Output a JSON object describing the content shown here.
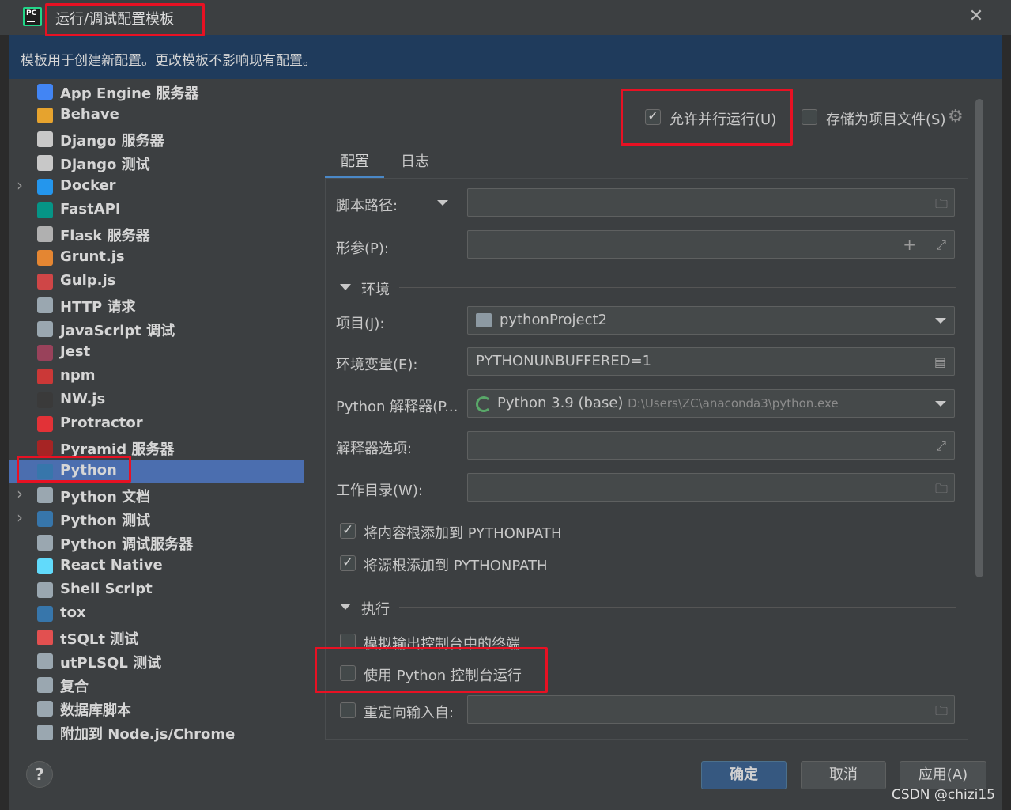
{
  "window": {
    "title": "运行/调试配置模板"
  },
  "banner": {
    "text": "模板用于创建新配置。更改模板不影响现有配置。"
  },
  "tree": {
    "items": [
      {
        "label": "App Engine 服务器",
        "icon": "app-engine-icon",
        "color": "#4285f4",
        "expandable": false
      },
      {
        "label": "Behave",
        "icon": "behave-icon",
        "color": "#e6a32e",
        "expandable": false
      },
      {
        "label": "Django 服务器",
        "icon": "django-icon",
        "color": "#c8c8c8",
        "expandable": false
      },
      {
        "label": "Django 测试",
        "icon": "django-test-icon",
        "color": "#c8c8c8",
        "expandable": false
      },
      {
        "label": "Docker",
        "icon": "docker-icon",
        "color": "#2496ed",
        "expandable": true
      },
      {
        "label": "FastAPI",
        "icon": "fastapi-icon",
        "color": "#059486",
        "expandable": false
      },
      {
        "label": "Flask 服务器",
        "icon": "flask-icon",
        "color": "#b0b0b0",
        "expandable": false
      },
      {
        "label": "Grunt.js",
        "icon": "grunt-icon",
        "color": "#e48632",
        "expandable": false
      },
      {
        "label": "Gulp.js",
        "icon": "gulp-icon",
        "color": "#cf4647",
        "expandable": false
      },
      {
        "label": "HTTP 请求",
        "icon": "http-api-icon",
        "color": "#9aa7b0",
        "expandable": false
      },
      {
        "label": "JavaScript 调试",
        "icon": "js-debug-icon",
        "color": "#9aa7b0",
        "expandable": false
      },
      {
        "label": "Jest",
        "icon": "jest-icon",
        "color": "#99425b",
        "expandable": false
      },
      {
        "label": "npm",
        "icon": "npm-icon",
        "color": "#cb3837",
        "expandable": false
      },
      {
        "label": "NW.js",
        "icon": "nwjs-icon",
        "color": "#3a3a3a",
        "expandable": false
      },
      {
        "label": "Protractor",
        "icon": "protractor-icon",
        "color": "#e23237",
        "expandable": false
      },
      {
        "label": "Pyramid 服务器",
        "icon": "pyramid-icon",
        "color": "#a62424",
        "expandable": false
      },
      {
        "label": "Python",
        "icon": "python-icon",
        "color": "#3776ab",
        "expandable": false,
        "selected": true
      },
      {
        "label": "Python 文档",
        "icon": "python-docs-icon",
        "color": "#9aa7b0",
        "expandable": true
      },
      {
        "label": "Python 测试",
        "icon": "python-test-icon",
        "color": "#3776ab",
        "expandable": true
      },
      {
        "label": "Python 调试服务器",
        "icon": "python-debug-server-icon",
        "color": "#9aa7b0",
        "expandable": false
      },
      {
        "label": "React Native",
        "icon": "react-icon",
        "color": "#61dafb",
        "expandable": false
      },
      {
        "label": "Shell Script",
        "icon": "shell-icon",
        "color": "#9aa7b0",
        "expandable": false
      },
      {
        "label": "tox",
        "icon": "tox-icon",
        "color": "#3776ab",
        "expandable": false
      },
      {
        "label": "tSQLt 测试",
        "icon": "tsqlt-icon",
        "color": "#e25050",
        "expandable": false
      },
      {
        "label": "utPLSQL 测试",
        "icon": "utplsql-icon",
        "color": "#9aa7b0",
        "expandable": false
      },
      {
        "label": "复合",
        "icon": "compound-icon",
        "color": "#9aa7b0",
        "expandable": false
      },
      {
        "label": "数据库脚本",
        "icon": "database-script-icon",
        "color": "#9aa7b0",
        "expandable": false
      },
      {
        "label": "附加到 Node.js/Chrome",
        "icon": "attach-node-icon",
        "color": "#9aa7b0",
        "expandable": false
      }
    ]
  },
  "top_options": {
    "allow_parallel": {
      "label": "允许并行运行(U)",
      "checked": true
    },
    "store_as_project_file": {
      "label": "存储为项目文件(S)",
      "checked": false
    }
  },
  "tabs": [
    {
      "label": "配置",
      "active": true
    },
    {
      "label": "日志",
      "active": false
    }
  ],
  "form": {
    "script_path": {
      "label": "脚本路径:",
      "value": ""
    },
    "parameters": {
      "label": "形参(P):",
      "value": ""
    },
    "environment_section": {
      "label": "环境"
    },
    "project": {
      "label": "项目(J):",
      "value": "pythonProject2"
    },
    "env_vars": {
      "label": "环境变量(E):",
      "value": "PYTHONUNBUFFERED=1"
    },
    "interpreter": {
      "label": "Python 解释器(P...",
      "value": "Python 3.9 (base)",
      "path": "D:\\Users\\ZC\\anaconda3\\python.exe"
    },
    "interpreter_options": {
      "label": "解释器选项:",
      "value": ""
    },
    "working_dir": {
      "label": "工作目录(W):",
      "value": ""
    },
    "add_content_roots": {
      "label": "将内容根添加到 PYTHONPATH",
      "checked": true
    },
    "add_source_roots": {
      "label": "将源根添加到 PYTHONPATH",
      "checked": true
    },
    "execution_section": {
      "label": "执行"
    },
    "emulate_terminal": {
      "label": "模拟输出控制台中的终端",
      "checked": false
    },
    "run_with_console": {
      "label": "使用 Python 控制台运行",
      "checked": false
    },
    "redirect_input": {
      "label": "重定向输入自:",
      "checked": false,
      "value": ""
    }
  },
  "buttons": {
    "help": "?",
    "ok": "确定",
    "cancel": "取消",
    "apply": "应用(A)"
  },
  "watermark": "CSDN @chizi15"
}
